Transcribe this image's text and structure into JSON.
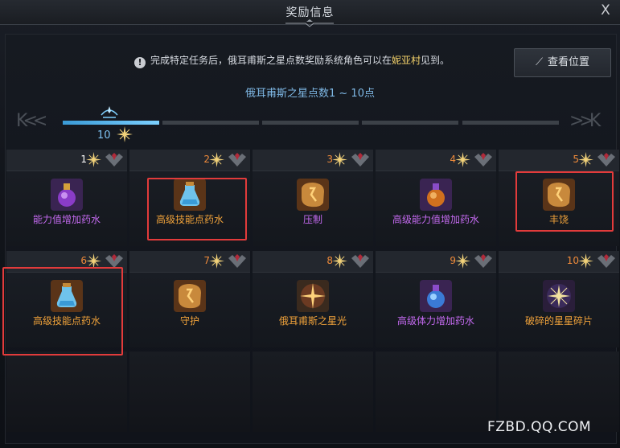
{
  "window": {
    "title": "奖励信息",
    "close_label": "X"
  },
  "notice": {
    "text_before": "完成特定任务后，俄耳甫斯之星点数奖励系统角色可以在",
    "highlight": "妮亚村",
    "text_after": "见到。"
  },
  "view_button": {
    "label": "查看位置"
  },
  "range_label": "俄耳甫斯之星点数1 ~ 10点",
  "nav": {
    "first": "K",
    "prev": "<",
    "next": ">",
    "last": "K"
  },
  "progress": {
    "current": "10",
    "filled_segments": 1,
    "total_segments": 5
  },
  "rewards": [
    {
      "num": "1",
      "name": "能力值增加药水",
      "icon": "purple-potion-icon",
      "name_color": "purple",
      "num_color": "white"
    },
    {
      "num": "2",
      "name": "高级技能点药水",
      "icon": "blue-potion-icon",
      "name_color": "orange",
      "num_color": "orange"
    },
    {
      "num": "3",
      "name": "压制",
      "icon": "rune-stone-icon",
      "name_color": "purple",
      "num_color": "orange"
    },
    {
      "num": "4",
      "name": "高级能力值增加药水",
      "icon": "orange-potion-icon",
      "name_color": "purple",
      "num_color": "orange"
    },
    {
      "num": "5",
      "name": "丰饶",
      "icon": "rune-stone-icon",
      "name_color": "orange",
      "num_color": "orange"
    },
    {
      "num": "6",
      "name": "高级技能点药水",
      "icon": "blue-potion-icon",
      "name_color": "orange",
      "num_color": "orange"
    },
    {
      "num": "7",
      "name": "守护",
      "icon": "rune-stone-icon",
      "name_color": "orange",
      "num_color": "orange"
    },
    {
      "num": "8",
      "name": "俄耳甫斯之星光",
      "icon": "star-orb-icon",
      "name_color": "orange",
      "num_color": "orange"
    },
    {
      "num": "9",
      "name": "高级体力增加药水",
      "icon": "blue-purple-potion-icon",
      "name_color": "purple",
      "num_color": "orange"
    },
    {
      "num": "10",
      "name": "破碎的星星碎片",
      "icon": "star-shard-icon",
      "name_color": "orange",
      "num_color": "orange"
    }
  ],
  "watermark": "FZBD.QQ.COM",
  "colors": {
    "accent": "#7fb9e6",
    "purple": "#c46af0",
    "orange": "#f0a23a",
    "highlight": "#e23b3b"
  }
}
